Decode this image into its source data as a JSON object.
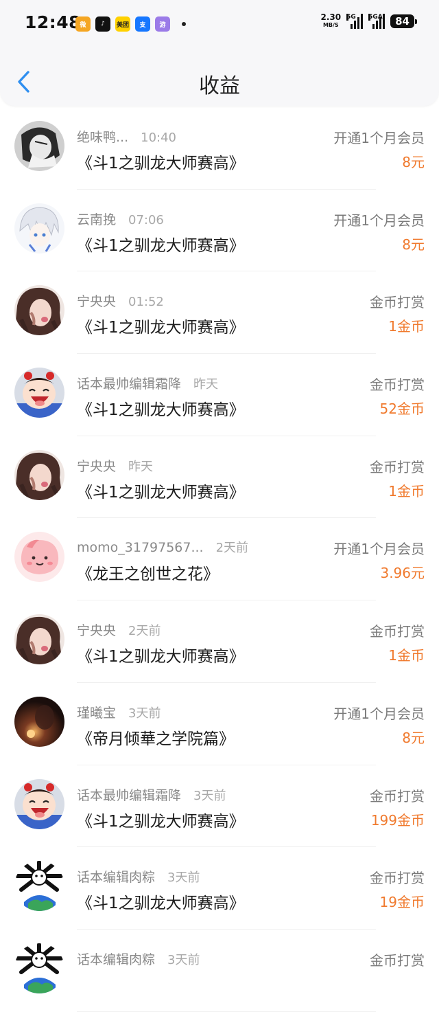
{
  "status_bar": {
    "time": "12:48",
    "net_speed": "2.30",
    "net_unit": "MB/S",
    "sig1_label": "5G",
    "sig2_label": "5GA",
    "battery": "84",
    "apps": [
      {
        "name": "weibo-icon",
        "glyph": "微",
        "color": "#f5a623"
      },
      {
        "name": "tiktok-icon",
        "glyph": "♪",
        "color": "#111111"
      },
      {
        "name": "meituan-icon",
        "glyph": "美团",
        "color": "#ffd100"
      },
      {
        "name": "alipay-icon",
        "glyph": "支",
        "color": "#1677ff"
      },
      {
        "name": "game-icon",
        "glyph": "游",
        "color": "#9b7be8"
      }
    ]
  },
  "header": {
    "title": "收益"
  },
  "accent": "#f07a2e",
  "rows": [
    {
      "user": "绝味鸭...",
      "time": "10:40",
      "book": "《斗1之驯龙大师赛高》",
      "type": "开通1个月会员",
      "amount": "8元",
      "avatar": "sketch"
    },
    {
      "user": "云南挽",
      "time": "07:06",
      "book": "《斗1之驯龙大师赛高》",
      "type": "开通1个月会员",
      "amount": "8元",
      "avatar": "anime"
    },
    {
      "user": "宁央央",
      "time": "01:52",
      "book": "《斗1之驯龙大师赛高》",
      "type": "金币打赏",
      "amount": "1金币",
      "avatar": "girl"
    },
    {
      "user": "话本最帅编辑霜降",
      "time": "昨天",
      "book": "《斗1之驯龙大师赛高》",
      "type": "金币打赏",
      "amount": "52金币",
      "avatar": "cartoon"
    },
    {
      "user": "宁央央",
      "time": "昨天",
      "book": "《斗1之驯龙大师赛高》",
      "type": "金币打赏",
      "amount": "1金币",
      "avatar": "girl"
    },
    {
      "user": "momo_31797567...",
      "time": "2天前",
      "book": "《龙王之创世之花》",
      "type": "开通1个月会员",
      "amount": "3.96元",
      "avatar": "pink"
    },
    {
      "user": "宁央央",
      "time": "2天前",
      "book": "《斗1之驯龙大师赛高》",
      "type": "金币打赏",
      "amount": "1金币",
      "avatar": "girl"
    },
    {
      "user": "瑾曦宝",
      "time": "3天前",
      "book": "《帝月倾華之学院篇》",
      "type": "开通1个月会员",
      "amount": "8元",
      "avatar": "dark"
    },
    {
      "user": "话本最帅编辑霜降",
      "time": "3天前",
      "book": "《斗1之驯龙大师赛高》",
      "type": "金币打赏",
      "amount": "199金币",
      "avatar": "cartoon"
    },
    {
      "user": "话本编辑肉粽",
      "time": "3天前",
      "book": "《斗1之驯龙大师赛高》",
      "type": "金币打赏",
      "amount": "19金币",
      "avatar": "bones"
    },
    {
      "user": "话本编辑肉粽",
      "time": "3天前",
      "book": "",
      "type": "金币打赏",
      "amount": "",
      "avatar": "bones"
    }
  ]
}
